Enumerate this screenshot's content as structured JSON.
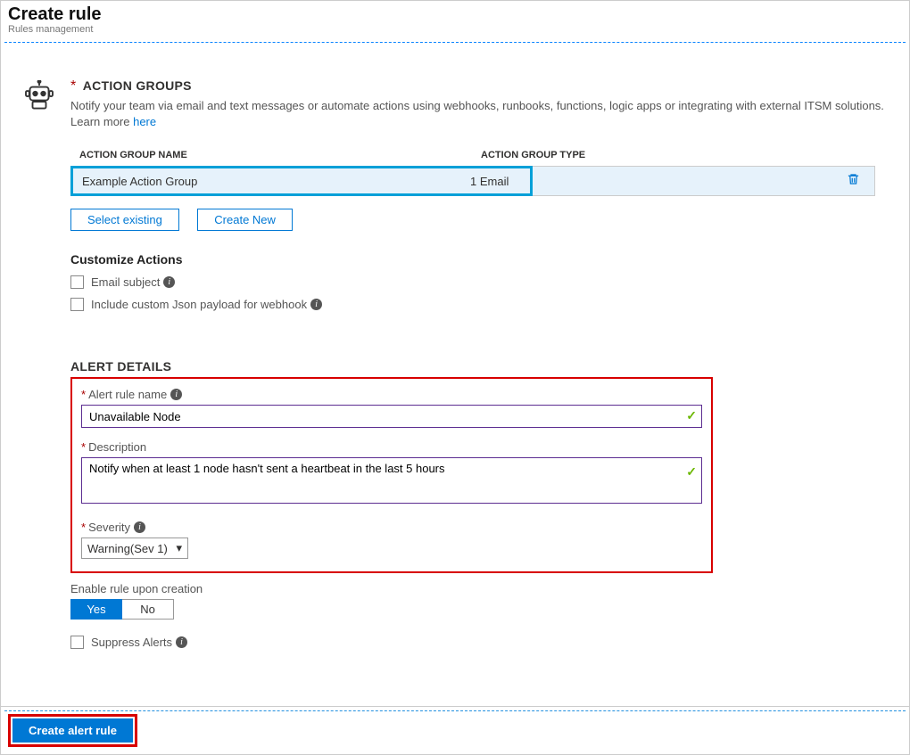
{
  "header": {
    "title": "Create rule",
    "subtitle": "Rules management"
  },
  "actionGroups": {
    "title": "ACTION GROUPS",
    "desc": "Notify your team via email and text messages or automate actions using webhooks, runbooks, functions, logic apps or integrating with external ITSM solutions. Learn more ",
    "learnMore": "here",
    "col1": "ACTION GROUP NAME",
    "col2": "ACTION GROUP TYPE",
    "row": {
      "name": "Example Action Group",
      "type": "1 Email"
    },
    "selectExisting": "Select existing",
    "createNew": "Create New"
  },
  "customize": {
    "title": "Customize Actions",
    "emailSubject": "Email subject",
    "jsonPayload": "Include custom Json payload for webhook"
  },
  "alertDetails": {
    "title": "ALERT DETAILS",
    "ruleNameLabel": "Alert rule name",
    "ruleNameValue": "Unavailable Node",
    "descLabel": "Description",
    "descValue": "Notify when at least 1 node hasn't sent a heartbeat in the last 5 hours",
    "sevLabel": "Severity",
    "sevValue": "Warning(Sev 1)"
  },
  "enable": {
    "label": "Enable rule upon creation",
    "yes": "Yes",
    "no": "No"
  },
  "suppress": {
    "label": "Suppress Alerts"
  },
  "footer": {
    "createBtn": "Create alert rule"
  }
}
